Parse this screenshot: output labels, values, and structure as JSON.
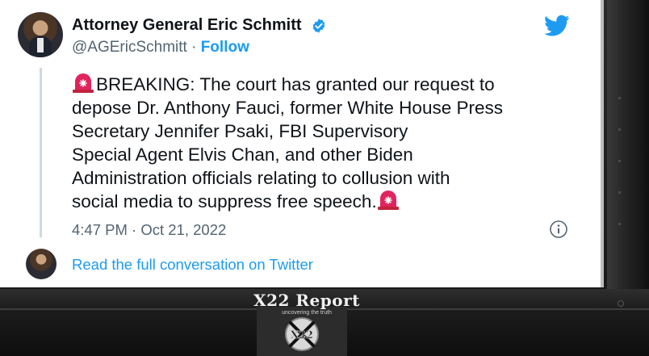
{
  "tweet": {
    "author_name": "Attorney General Eric Schmitt",
    "handle": "@AGEricSchmitt",
    "separator": "·",
    "follow_label": "Follow",
    "text_lines": [
      "BREAKING: The court has granted our request to",
      "depose Dr. Anthony Fauci, former White House Press",
      "Secretary Jennifer Psaki, FBI Supervisory",
      "Special Agent Elvis Chan, and other Biden",
      "Administration officials relating to collusion with",
      "social media to suppress free speech."
    ],
    "timestamp": "4:47 PM · Oct 21, 2022",
    "read_full_label": "Read the full conversation on Twitter",
    "icons": {
      "verified": "verified-badge-icon",
      "twitter": "twitter-bird-icon",
      "siren": "rotating-light-icon",
      "info": "info-icon"
    },
    "colors": {
      "link_blue": "#1d9bf0",
      "text": "#0f1419",
      "muted": "#536471",
      "siren_red": "#e0245e"
    }
  },
  "overlay": {
    "brand_title": "X22 Report",
    "brand_tagline": "uncovering the truth",
    "logo_text": "X22"
  }
}
